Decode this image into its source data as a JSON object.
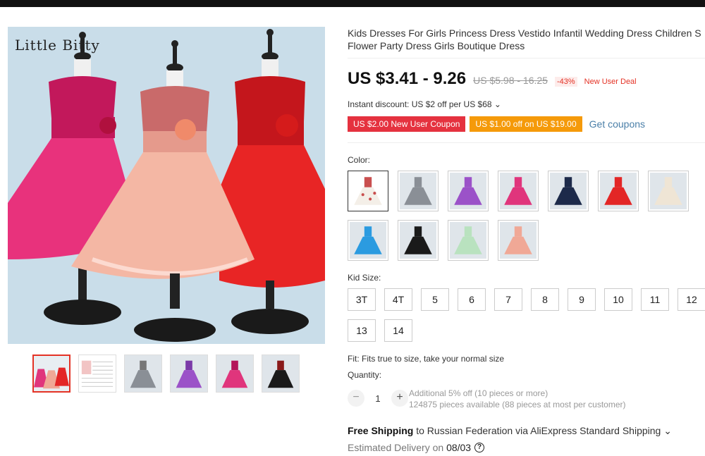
{
  "gallery": {
    "brand": "Little Bitty",
    "thumbnails": [
      {
        "name": "thumb-three-dresses",
        "colors": [
          "#e0357c",
          "#f0a896",
          "#e32626"
        ]
      },
      {
        "name": "thumb-size-chart",
        "colors": [
          "#ffffff"
        ]
      },
      {
        "name": "thumb-grey",
        "colors": [
          "#8a8f96"
        ]
      },
      {
        "name": "thumb-purple",
        "colors": [
          "#9b52c8"
        ]
      },
      {
        "name": "thumb-pink",
        "colors": [
          "#e0357c"
        ]
      },
      {
        "name": "thumb-black",
        "colors": [
          "#1a1a1a"
        ]
      }
    ]
  },
  "product": {
    "title_line1": "Kids Dresses For Girls Princess Dress Vestido Infantil Wedding Dress Children S",
    "title_line2": "Flower Party Dress Girls Boutique Dress"
  },
  "pricing": {
    "price": "US $3.41 - 9.26",
    "original_price": "US $5.98 - 16.25",
    "discount": "-43%",
    "deal": "New User Deal",
    "instant_discount": "Instant discount: US $2 off per US $68",
    "coupons": [
      "US $2.00 New User Coupon",
      "US $1.00 off on US $19.00"
    ],
    "get_coupons": "Get coupons",
    "accent_color": "#e43225"
  },
  "color_section": {
    "label": "Color:",
    "swatches": [
      {
        "name": "floral-print",
        "color": "#f4efe8",
        "accent": "#c94f4f"
      },
      {
        "name": "grey",
        "color": "#8a8f96"
      },
      {
        "name": "purple",
        "color": "#9b52c8"
      },
      {
        "name": "pink",
        "color": "#e0357c"
      },
      {
        "name": "navy",
        "color": "#1d2a4a"
      },
      {
        "name": "red",
        "color": "#e32626"
      },
      {
        "name": "champagne",
        "color": "#efe5d5"
      },
      {
        "name": "sky-blue",
        "color": "#2b9be0"
      },
      {
        "name": "black",
        "color": "#1a1a1a"
      },
      {
        "name": "mint",
        "color": "#b9e2bf"
      },
      {
        "name": "peach",
        "color": "#f0a896"
      }
    ]
  },
  "size_section": {
    "label": "Kid Size:",
    "sizes": [
      "3T",
      "4T",
      "5",
      "6",
      "7",
      "8",
      "9",
      "10",
      "11",
      "12",
      "13",
      "14"
    ],
    "fit": "Fit: Fits true to size, take your normal size"
  },
  "quantity": {
    "label": "Quantity:",
    "value": "1",
    "minus": "−",
    "plus": "+",
    "info_line1": "Additional 5% off (10 pieces or more)",
    "info_line2": "124875 pieces available (88 pieces at most per customer)"
  },
  "shipping": {
    "bold": "Free Shipping",
    "text": " to Russian Federation via AliExpress Standard Shipping ⌄",
    "delivery_label": "Estimated Delivery on ",
    "delivery_date": "08/03",
    "help": "?"
  }
}
